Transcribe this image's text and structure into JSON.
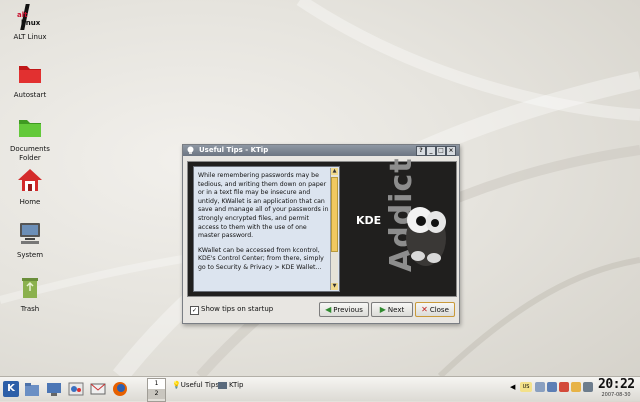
{
  "desktop": {
    "icons": [
      {
        "label": "ALT Linux"
      },
      {
        "label": "Autostart"
      },
      {
        "label": "Documents Folder"
      },
      {
        "label": "Home"
      },
      {
        "label": "System"
      },
      {
        "label": "Trash"
      }
    ],
    "logo_text_top": "alt",
    "logo_text_bottom": "linux"
  },
  "dialog": {
    "title": "Useful Tips - KTip",
    "tb_help": "?",
    "tb_min": "_",
    "tb_max": "□",
    "tb_close": "×",
    "tip_paragraph_1": "While remembering passwords may be tedious, and writing them down on paper or in a text file may be insecure and untidy, KWallet is an application that can save and manage all of your passwords in strongly encrypted files, and permit access to them with the use of one master password.",
    "tip_paragraph_2": "KWallet can be accessed from kcontrol, KDE's Control Center; from there, simply go to Security & Privacy > KDE Wallet...",
    "image_kde": "KDE",
    "image_addict": "Addict",
    "show_tips_label": "Show tips on startup",
    "show_tips_checked": true,
    "previous_label": "Previous",
    "next_label": "Next",
    "close_label": "Close"
  },
  "taskbar": {
    "pager_desktop_1": "1",
    "pager_desktop_2": "2",
    "task_1": "Useful Tips",
    "task_2": "KTip",
    "tray_lang": "US",
    "clock_time": "20:22",
    "clock_date": "2007-08-30"
  }
}
